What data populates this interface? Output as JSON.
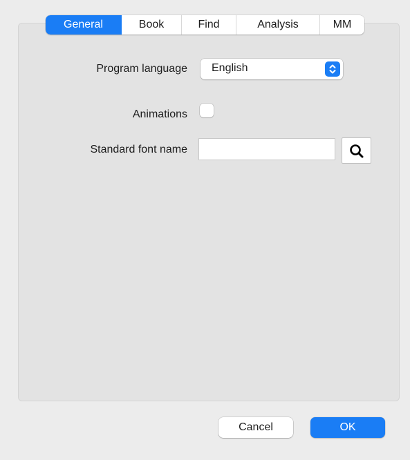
{
  "tabs": [
    {
      "label": "General",
      "active": true
    },
    {
      "label": "Book",
      "active": false
    },
    {
      "label": "Find",
      "active": false
    },
    {
      "label": "Analysis",
      "active": false
    },
    {
      "label": "MM",
      "active": false
    }
  ],
  "general": {
    "program_language": {
      "label": "Program language",
      "value": "English"
    },
    "animations": {
      "label": "Animations",
      "checked": false
    },
    "standard_font_name": {
      "label": "Standard font name",
      "value": "",
      "placeholder": ""
    }
  },
  "footer": {
    "cancel_label": "Cancel",
    "ok_label": "OK"
  },
  "colors": {
    "accent": "#1a7df5",
    "background": "#ececec",
    "panel": "#e3e3e3"
  },
  "icons": {
    "language_select": "up-down-chevron-icon",
    "font_search": "search-icon"
  }
}
